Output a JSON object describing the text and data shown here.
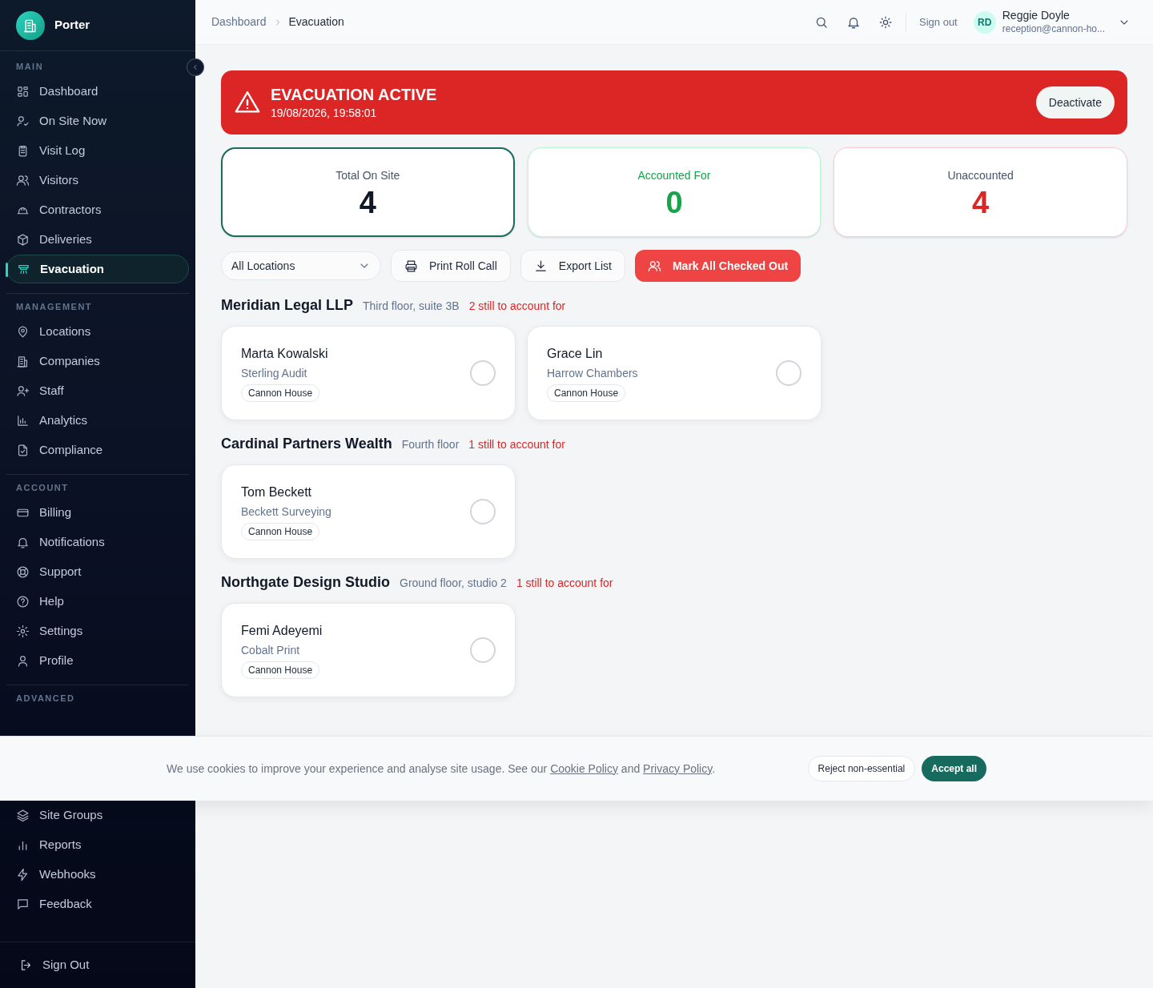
{
  "brand": {
    "name": "Porter"
  },
  "sidebar": {
    "sections": [
      {
        "heading": "MAIN",
        "items": [
          {
            "label": "Dashboard",
            "selected": false
          },
          {
            "label": "On Site Now",
            "selected": false
          },
          {
            "label": "Visit Log",
            "selected": false
          },
          {
            "label": "Visitors",
            "selected": false
          },
          {
            "label": "Contractors",
            "selected": false
          },
          {
            "label": "Deliveries",
            "selected": false
          },
          {
            "label": "Evacuation",
            "selected": true
          }
        ]
      },
      {
        "heading": "MANAGEMENT",
        "items": [
          {
            "label": "Locations",
            "selected": false
          },
          {
            "label": "Companies",
            "selected": false
          },
          {
            "label": "Staff",
            "selected": false
          },
          {
            "label": "Analytics",
            "selected": false
          },
          {
            "label": "Compliance",
            "selected": false
          }
        ]
      },
      {
        "heading": "ACCOUNT",
        "items": [
          {
            "label": "Billing",
            "selected": false
          },
          {
            "label": "Notifications",
            "selected": false
          },
          {
            "label": "Support",
            "selected": false
          },
          {
            "label": "Help",
            "selected": false
          },
          {
            "label": "Settings",
            "selected": false
          },
          {
            "label": "Profile",
            "selected": false
          }
        ]
      },
      {
        "heading": "ADVANCED",
        "items": [
          {
            "label": "Site Groups",
            "selected": false
          },
          {
            "label": "Reports",
            "selected": false
          },
          {
            "label": "Webhooks",
            "selected": false
          },
          {
            "label": "Feedback",
            "selected": false
          }
        ]
      }
    ],
    "sign_out": "Sign Out"
  },
  "breadcrumb": [
    "Dashboard",
    "Evacuation"
  ],
  "header": {
    "sign_out": "Sign out",
    "user": {
      "initials": "RD",
      "name": "Reggie Doyle",
      "email": "reception@cannon-ho..."
    }
  },
  "banner": {
    "title": "EVACUATION ACTIVE",
    "time": "19/08/2026, 19:58:01",
    "button": "Deactivate"
  },
  "stats": [
    {
      "label": "Total On Site",
      "value": "4",
      "kind": "total",
      "selected": true
    },
    {
      "label": "Accounted For",
      "value": "0",
      "kind": "good",
      "selected": false
    },
    {
      "label": "Unaccounted",
      "value": "4",
      "kind": "bad",
      "selected": false
    }
  ],
  "toolbar": {
    "location_filter": "All Locations",
    "buttons": [
      {
        "label": "Print Roll Call",
        "kind": "outline"
      },
      {
        "label": "Export List",
        "kind": "outline"
      },
      {
        "label": "Mark All Checked Out",
        "kind": "danger"
      }
    ]
  },
  "groups": [
    {
      "company": "Meridian Legal LLP",
      "location": "Third floor, suite 3B",
      "remaining": "2 still to account for",
      "people": [
        {
          "name": "Marta Kowalski",
          "company": "Sterling Audit",
          "site": "Cannon House",
          "checked": false
        },
        {
          "name": "Grace Lin",
          "company": "Harrow Chambers",
          "site": "Cannon House",
          "checked": false
        }
      ]
    },
    {
      "company": "Cardinal Partners Wealth",
      "location": "Fourth floor",
      "remaining": "1 still to account for",
      "people": [
        {
          "name": "Tom Beckett",
          "company": "Beckett Surveying",
          "site": "Cannon House",
          "checked": false
        }
      ]
    },
    {
      "company": "Northgate Design Studio",
      "location": "Ground floor, studio 2",
      "remaining": "1 still to account for",
      "people": [
        {
          "name": "Femi Adeyemi",
          "company": "Cobalt Print",
          "site": "Cannon House",
          "checked": false
        }
      ]
    }
  ],
  "cookie_banner": {
    "text_before": "We use cookies to improve your experience and analyse site usage. See our",
    "cookie_link": "Cookie Policy",
    "text_middle": "and",
    "privacy_link": "Privacy Policy",
    "text_after": ".",
    "reject": "Reject non-essential",
    "accept": "Accept all"
  }
}
